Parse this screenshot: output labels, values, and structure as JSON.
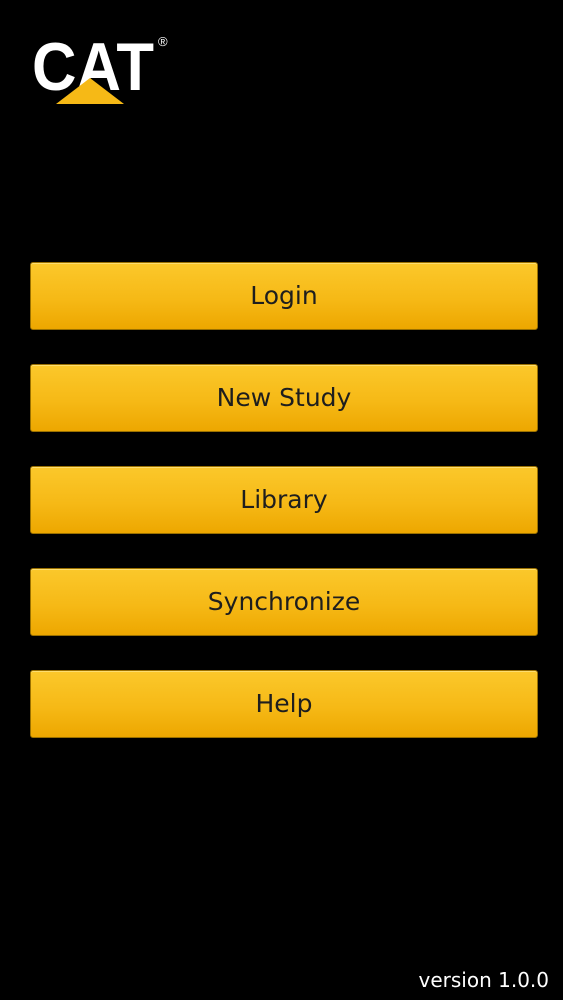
{
  "logo": {
    "text": "CAT",
    "registered_mark": "®",
    "colors": {
      "letters": "#ffffff",
      "triangle": "#f6b916"
    }
  },
  "menu": {
    "items": [
      {
        "label": "Login"
      },
      {
        "label": "New Study"
      },
      {
        "label": "Library"
      },
      {
        "label": "Synchronize"
      },
      {
        "label": "Help"
      }
    ]
  },
  "footer": {
    "version": "version 1.0.0"
  },
  "colors": {
    "background": "#000000",
    "button_fill": "#f6b916",
    "button_text": "#1e1e1e",
    "footer_text": "#ffffff"
  }
}
